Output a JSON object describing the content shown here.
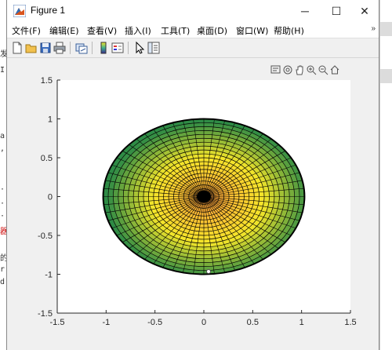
{
  "window": {
    "title": "Figure 1",
    "minimize": "─",
    "maximize": "☐",
    "close": "✕"
  },
  "menu": [
    {
      "label": "文件(F)"
    },
    {
      "label": "编辑(E)"
    },
    {
      "label": "查看(V)"
    },
    {
      "label": "插入(I)"
    },
    {
      "label": "工具(T)"
    },
    {
      "label": "桌面(D)"
    },
    {
      "label": "窗口(W)"
    },
    {
      "label": "帮助(H)"
    }
  ],
  "menu_overflow": "»",
  "toolbar_icons": [
    "new-figure-icon",
    "open-file-icon",
    "save-icon",
    "print-icon",
    "link-plot-icon",
    "insert-colorbar-icon",
    "insert-legend-icon",
    "select-pointer-icon",
    "property-inspector-icon"
  ],
  "axes_toolbar_icons": [
    "data-tips-icon",
    "rotate-3d-icon",
    "pan-icon",
    "zoom-in-icon",
    "zoom-out-icon",
    "home-icon"
  ],
  "colors": {
    "surface_center": "#ff9f3a",
    "surface_mid": "#f5e62a",
    "surface_edge": "#2e8b45",
    "mesh": "#000000"
  },
  "chart_data": {
    "type": "surface",
    "description_view": "top view of mesh surface, ellipsoid",
    "xlim": [
      -1.5,
      1.5
    ],
    "ylim": [
      -1.5,
      1.5
    ],
    "x_ticks": [
      "-1.5",
      "-1",
      "-0.5",
      "0",
      "0.5",
      "1",
      "1.5"
    ],
    "y_ticks": [
      "1.5",
      "1",
      "0.5",
      "0",
      "-0.5",
      "-1",
      "-1.5"
    ],
    "ellipse_semi_axis_x": 1.03,
    "ellipse_semi_axis_y": 1.0,
    "radial_lines": 60,
    "rings": 20,
    "grid": false
  },
  "left_fragments": [
    "a",
    ",",
    "·",
    "·",
    "·",
    "器",
    "的",
    "r",
    "d"
  ]
}
